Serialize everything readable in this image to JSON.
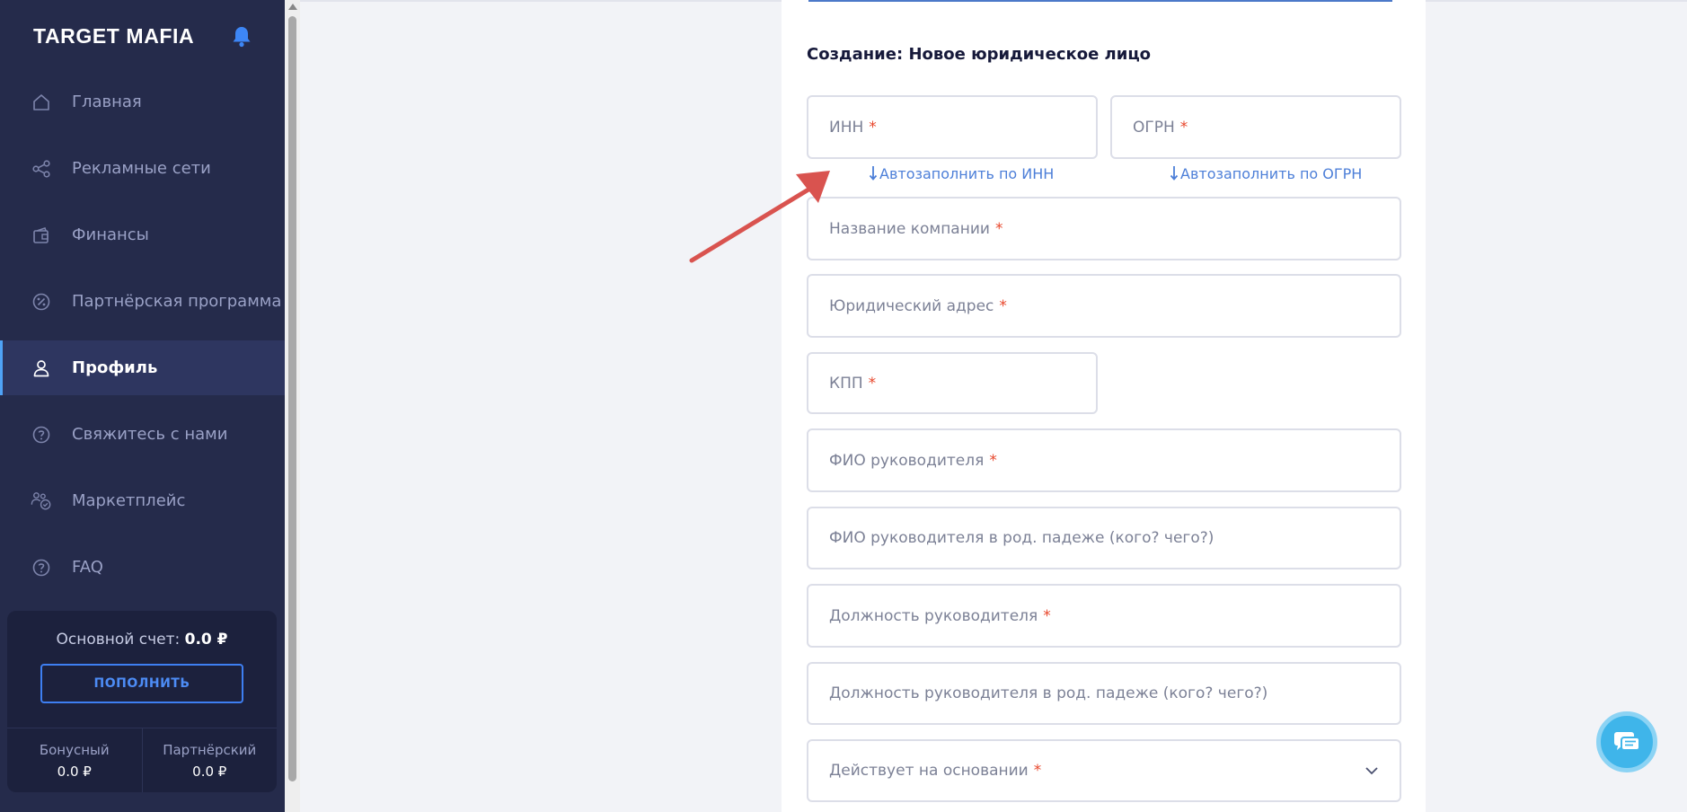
{
  "sidebar": {
    "brand": "TARGET MAFIA",
    "items": [
      {
        "label": "Главная",
        "icon": "home-icon"
      },
      {
        "label": "Рекламные сети",
        "icon": "share-icon"
      },
      {
        "label": "Финансы",
        "icon": "wallet-icon"
      },
      {
        "label": "Партнёрская программа",
        "icon": "percent-icon"
      },
      {
        "label": "Профиль",
        "icon": "user-icon",
        "active": true
      },
      {
        "label": "Свяжитесь с нами",
        "icon": "help-icon"
      },
      {
        "label": "Маркетплейс",
        "icon": "users-check-icon"
      },
      {
        "label": "FAQ",
        "icon": "faq-icon"
      }
    ],
    "account": {
      "main_label": "Основной счет:",
      "main_value": "0.0 ₽",
      "topup_label": "ПОПОЛНИТЬ",
      "bonus_label": "Бонусный",
      "bonus_value": "0.0 ₽",
      "partner_label": "Партнёрский",
      "partner_value": "0.0 ₽"
    }
  },
  "form": {
    "title": "Создание: Новое юридическое лицо",
    "required_mark": "*",
    "fields": {
      "inn": "ИНН",
      "ogrn": "ОГРН",
      "company_name": "Название компании",
      "legal_address": "Юридический адрес",
      "kpp": "КПП",
      "director_name": "ФИО руководителя",
      "director_name_genitive": "ФИО руководителя в род. падеже (кого? чего?)",
      "director_position": "Должность руководителя",
      "director_position_genitive": "Должность руководителя в род. падеже (кого? чего?)",
      "acts_on_basis": "Действует на основании"
    },
    "autofill_inn": "Автозаполнить по ИНН",
    "autofill_ogrn": "Автозаполнить по ОГРН"
  },
  "colors": {
    "sidebar_bg": "#252b4b",
    "accent_blue": "#4d8cf5",
    "required_red": "#e8472c",
    "annotation_arrow": "#d9534f",
    "chat_button": "#3fb5ea"
  }
}
